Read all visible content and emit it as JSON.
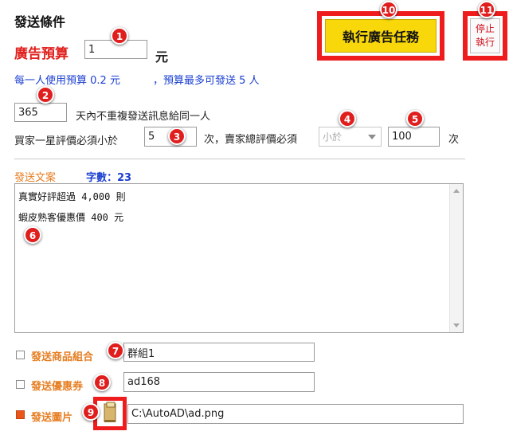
{
  "section_title": "發送條件",
  "budget": {
    "label": "廣告預算",
    "value": "1",
    "unit": "元"
  },
  "budget_info": {
    "per_person": "每一人使用預算 0.2 元",
    "max_send": "，預算最多可發送 5 人"
  },
  "days": {
    "value": "365",
    "label": "天內不重複發送訊息給同一人"
  },
  "rating": {
    "buyer_label": "買家一星評價必須小於",
    "buyer_value": "5",
    "seller_label": "次，賣家總評價必須",
    "compare_selected": "小於",
    "seller_value": "100",
    "unit": "次"
  },
  "copy": {
    "label": "發送文案",
    "count_label": "字數：23",
    "lines": [
      "真實好評超過 4,000 則",
      "蝦皮熟客優惠價 400 元"
    ]
  },
  "options": {
    "product_group": {
      "label": "發送商品組合",
      "value": "群組1",
      "checked": false
    },
    "coupon": {
      "label": "發送優惠券",
      "value": "ad168",
      "checked": false
    },
    "image": {
      "label": "發送圖片",
      "value": "C:\\AutoAD\\ad.png",
      "checked": true
    }
  },
  "buttons": {
    "run": "執行廣告任務",
    "stop_line1": "停止",
    "stop_line2": "執行"
  },
  "badges": [
    "1",
    "2",
    "3",
    "4",
    "5",
    "6",
    "7",
    "8",
    "9",
    "10",
    "11"
  ],
  "colors": {
    "accent_red": "#ee1c1c",
    "run_yellow": "#f8d80a",
    "label_orange": "#e67e22",
    "info_blue": "#1a3fd0"
  }
}
